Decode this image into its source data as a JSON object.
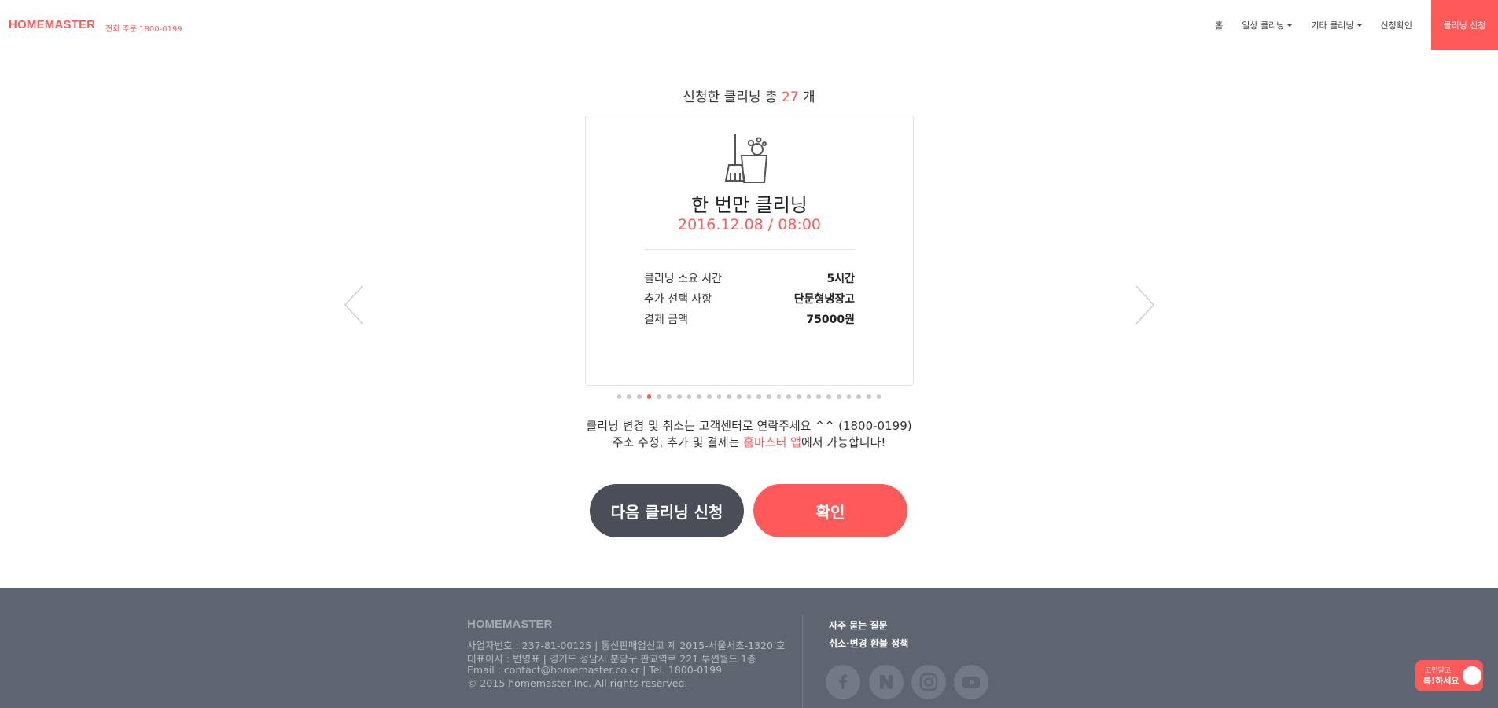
{
  "header": {
    "logo": "HOMEMASTER",
    "phone": "전화 주문 1800-0199",
    "nav": [
      {
        "label": "홈",
        "dropdown": false
      },
      {
        "label": "일상 클리닝",
        "dropdown": true
      },
      {
        "label": "기타 클리닝",
        "dropdown": true
      },
      {
        "label": "신청확인",
        "dropdown": false
      }
    ],
    "cta_label": "클리닝 신청"
  },
  "summary": {
    "prefix": "신청한 클리닝 총",
    "count": "27",
    "suffix": "개"
  },
  "card": {
    "icon": "broom-bucket-icon",
    "name": "한 번만 클리닝",
    "datetime": "2016.12.08 / 08:00",
    "details": [
      {
        "label": "클리닝 소요 시간",
        "value": "5시간"
      },
      {
        "label": "추가 선택 사항",
        "value": "단문형냉장고"
      },
      {
        "label": "결제 금액",
        "value": "75000원"
      }
    ]
  },
  "carousel": {
    "total": 27,
    "active_index": 3
  },
  "notice": {
    "line1": "클리닝 변경 및 취소는 고객센터로 연락주세요 ^^ (1800-0199)",
    "line2_prefix": "주소 수정, 추가 및 결제는 ",
    "line2_highlight": "홈마스터 앱",
    "line2_suffix": "에서 가능합니다!"
  },
  "buttons": {
    "next": "다음 클리닝 신청",
    "confirm": "확인"
  },
  "footer": {
    "logo": "HOMEMASTER",
    "info": [
      "사업자번호 : 237-81-00125 | 통신판매업신고 제 2015-서울서초-1320 호",
      "대표이사 : 변영표 | 경기도 성남시 분당구 판교역로 221 투썬월드 1층",
      "Email : contact@homemaster.co.kr | Tel. 1800-0199",
      "© 2015 homemaster,Inc. All rights reserved."
    ],
    "links": [
      "자주 묻는 질문",
      "취소·변경 환불 정책"
    ],
    "social": [
      "facebook-icon",
      "naver-icon",
      "instagram-icon",
      "youtube-icon"
    ]
  },
  "chat": {
    "line1": "고민말고",
    "line2": "톡!하세요"
  },
  "colors": {
    "accent": "#ff5a5a",
    "dark_button": "#4a4e59",
    "footer_bg": "#5e6470"
  }
}
